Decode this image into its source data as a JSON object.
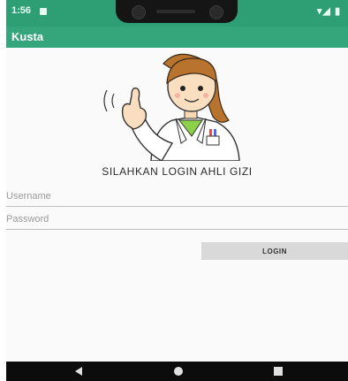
{
  "status_bar": {
    "time": "1:56",
    "icons": "▾◢ ▮"
  },
  "app_bar": {
    "title": "Kusta"
  },
  "illustration": {
    "icon": "doctor-waving-illustration"
  },
  "login": {
    "heading": "SILAHKAN LOGIN AHLI GIZI",
    "username_placeholder": "Username",
    "password_placeholder": "Password",
    "button_label": "LOGIN"
  },
  "nav_bar": {
    "icons": [
      "back-icon",
      "home-icon",
      "recents-icon"
    ]
  },
  "colors": {
    "status_bar": "#2e9e74",
    "app_bar": "#35a57c",
    "button": "#d9d9d9"
  }
}
